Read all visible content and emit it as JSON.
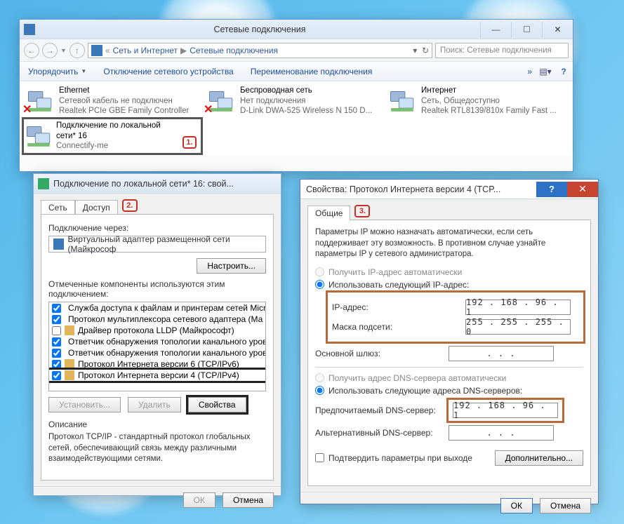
{
  "main": {
    "title": "Сетевые подключения",
    "breadcrumb": {
      "root": "Сеть и Интернет",
      "leaf": "Сетевые подключения"
    },
    "search_placeholder": "Поиск: Сетевые подключения",
    "toolbar": {
      "organize": "Упорядочить",
      "disable": "Отключение сетевого устройства",
      "rename": "Переименование подключения"
    },
    "connections": [
      {
        "name": "Ethernet",
        "status": "Сетевой кабель не подключен",
        "adapter": "Realtek PCIe GBE Family Controller",
        "has_x": true
      },
      {
        "name": "Беспроводная сеть",
        "status": "Нет подключения",
        "adapter": "D-Link DWA-525 Wireless N 150 D...",
        "has_x": true
      },
      {
        "name": "Интернет",
        "status": "Сеть, Общедоступно",
        "adapter": "Realtek RTL8139/810x Family Fast ...",
        "has_x": false
      },
      {
        "name": "Подключение по локальной сети* 16",
        "status": "",
        "adapter": "Connectify-me",
        "has_x": false,
        "selected": true
      }
    ],
    "annotation1": "1."
  },
  "dlg1": {
    "title": "Подключение по локальной сети* 16: свой...",
    "tabs": {
      "net": "Сеть",
      "access": "Доступ"
    },
    "annotation2": "2.",
    "connect_via_label": "Подключение через:",
    "adapter": "Виртуальный адаптер размещенной сети (Майкрософ",
    "configure_btn": "Настроить...",
    "components_label": "Отмеченные компоненты используются этим подключением:",
    "components": [
      {
        "checked": true,
        "text": "Служба доступа к файлам и принтерам сетей Micro"
      },
      {
        "checked": true,
        "text": "Протокол мультиплексора сетевого адаптера (Ма"
      },
      {
        "checked": false,
        "text": "Драйвер протокола LLDP (Майкрософт)"
      },
      {
        "checked": true,
        "text": "Ответчик обнаружения топологии канального уров"
      },
      {
        "checked": true,
        "text": "Ответчик обнаружения топологии канального уров"
      },
      {
        "checked": true,
        "text": "Протокол Интернета версии 6 (TCP/IPv6)"
      },
      {
        "checked": true,
        "text": "Протокол Интернета версии 4 (TCP/IPv4)",
        "selected": true
      }
    ],
    "install_btn": "Установить...",
    "remove_btn": "Удалить",
    "props_btn": "Свойства",
    "desc_header": "Описание",
    "desc_text": "Протокол TCP/IP - стандартный протокол глобальных сетей, обеспечивающий связь между различными взаимодействующими сетями.",
    "ok": "ОК",
    "cancel": "Отмена"
  },
  "dlg2": {
    "title": "Свойства: Протокол Интернета версии 4 (TCP...",
    "tab_general": "Общие",
    "annotation3": "3.",
    "info": "Параметры IP можно назначать автоматически, если сеть поддерживает эту возможность. В противном случае узнайте параметры IP у сетевого администратора.",
    "radio_auto_ip": "Получить IP-адрес автоматически",
    "radio_manual_ip": "Использовать следующий IP-адрес:",
    "ip_label": "IP-адрес:",
    "ip_value": "192 . 168 .  96  .   1",
    "mask_label": "Маска подсети:",
    "mask_value": "255 . 255 . 255 .   0",
    "gw_label": "Основной шлюз:",
    "gw_value": ".       .       .",
    "radio_auto_dns": "Получить адрес DNS-сервера автоматически",
    "radio_manual_dns": "Использовать следующие адреса DNS-серверов:",
    "dns1_label": "Предпочитаемый DNS-сервер:",
    "dns1_value": "192 . 168 .  96  .   1",
    "dns2_label": "Альтернативный DNS-сервер:",
    "dns2_value": ".       .       .",
    "confirm_label": "Подтвердить параметры при выходе",
    "advanced_btn": "Дополнительно...",
    "ok": "ОК",
    "cancel": "Отмена"
  }
}
